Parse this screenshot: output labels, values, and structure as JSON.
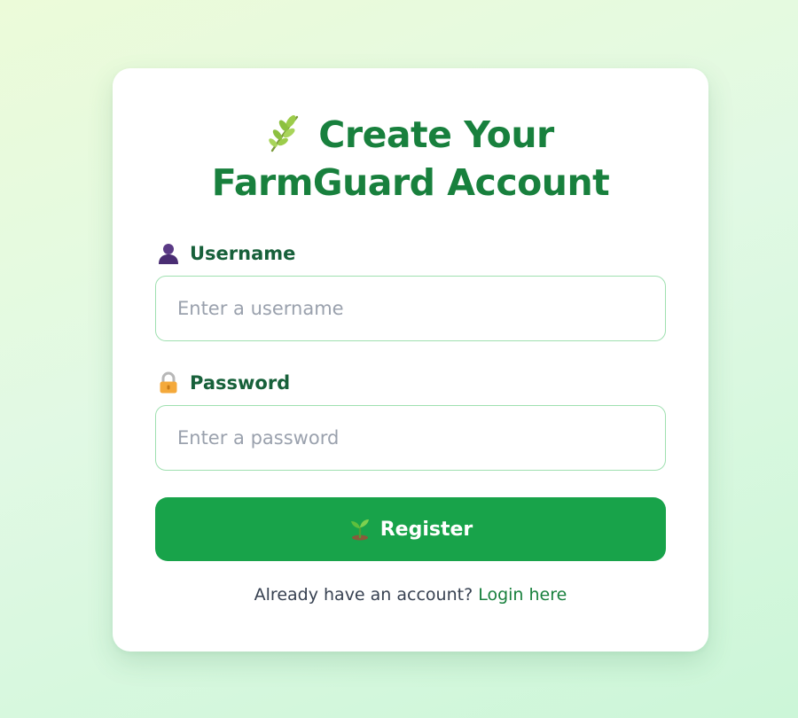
{
  "colors": {
    "title": "#18803d",
    "label": "#17603a",
    "button_bg": "#18a34a",
    "input_border": "#9fe0b0",
    "link": "#18803d"
  },
  "header": {
    "icon": "herb-icon",
    "title_line1": "Create Your",
    "title_line2": "FarmGuard Account"
  },
  "form": {
    "username": {
      "icon": "user-silhouette-icon",
      "label": "Username",
      "placeholder": "Enter a username",
      "value": ""
    },
    "password": {
      "icon": "lock-icon",
      "label": "Password",
      "placeholder": "Enter a password",
      "value": ""
    },
    "submit": {
      "icon": "seedling-icon",
      "label": "Register"
    }
  },
  "footer": {
    "prompt": "Already have an account?",
    "link_label": "Login here"
  }
}
